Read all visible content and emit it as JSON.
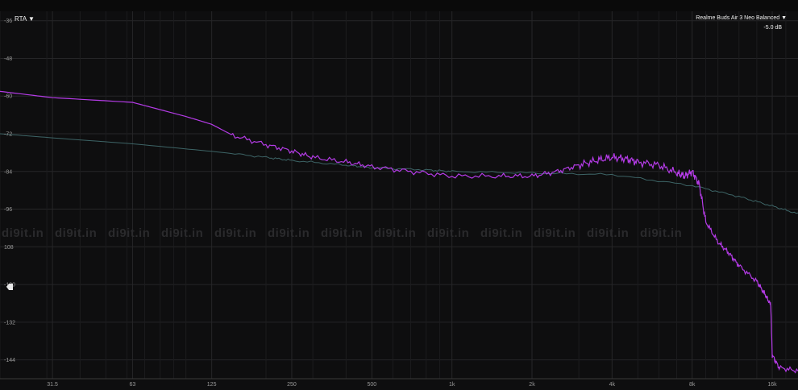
{
  "toolbar": {
    "mode_label": "RTA ▼",
    "device_label": "Realme Buds Air 3 Neo  Balanced ▼",
    "gain_readout": "-5.0 dB"
  },
  "watermark": "di9it.in",
  "colors": {
    "background": "#0e0e0f",
    "grid": "#262628",
    "series_measured": "#b43be6",
    "series_reference": "#3d6466"
  },
  "chart_data": {
    "type": "line",
    "title": "",
    "xlabel": "",
    "ylabel": "",
    "x_scale": "log",
    "xlim": [
      20,
      20000
    ],
    "ylim": [
      -150,
      -33
    ],
    "grid": true,
    "x_ticks": [
      31.5,
      63,
      125,
      250,
      500,
      1000,
      2000,
      4000,
      8000,
      16000
    ],
    "x_tick_labels": [
      "31.5",
      "63",
      "125",
      "250",
      "500",
      "1k",
      "2k",
      "4k",
      "8k",
      "16k"
    ],
    "y_ticks": [
      -36,
      -48,
      -60,
      -72,
      -84,
      -96,
      -108,
      -120,
      -132,
      -144
    ],
    "y_tick_labels": [
      "-36",
      "-48",
      "-60",
      "-72",
      "-84",
      "-96",
      "108",
      "-120",
      "-132",
      "-144"
    ],
    "series": [
      {
        "color": "#3d6466",
        "x": [
          20,
          31.5,
          63,
          125,
          200,
          250,
          400,
          500,
          800,
          1000,
          2000,
          4000,
          8000,
          12000,
          16000,
          20000
        ],
        "y": [
          -72,
          -73.3,
          -75.2,
          -77.6,
          -79.5,
          -80.5,
          -82,
          -82.8,
          -83.5,
          -84,
          -84.5,
          -85,
          -88.5,
          -92,
          -95,
          -97.5
        ]
      },
      {
        "color": "#b43be6",
        "x": [
          20,
          31.5,
          63,
          100,
          125,
          150,
          200,
          250,
          300,
          400,
          500,
          700,
          1000,
          1500,
          2000,
          2500,
          3000,
          3500,
          4000,
          4500,
          5000,
          6000,
          7000,
          7500,
          8000,
          8500,
          9000,
          10000,
          11000,
          12000,
          14000,
          15000,
          15800,
          16000,
          17000,
          20000
        ],
        "y": [
          -58.5,
          -60.5,
          -62,
          -66.5,
          -69,
          -72.5,
          -75.5,
          -77.5,
          -79.5,
          -81,
          -82.5,
          -84,
          -85.5,
          -85.5,
          -85.5,
          -84,
          -82,
          -80.5,
          -79.5,
          -80,
          -81,
          -82,
          -84.5,
          -85.5,
          -84,
          -88,
          -100,
          -106.5,
          -110,
          -114,
          -119,
          -123,
          -126.5,
          -142.5,
          -146.5,
          -147.5
        ]
      }
    ]
  }
}
